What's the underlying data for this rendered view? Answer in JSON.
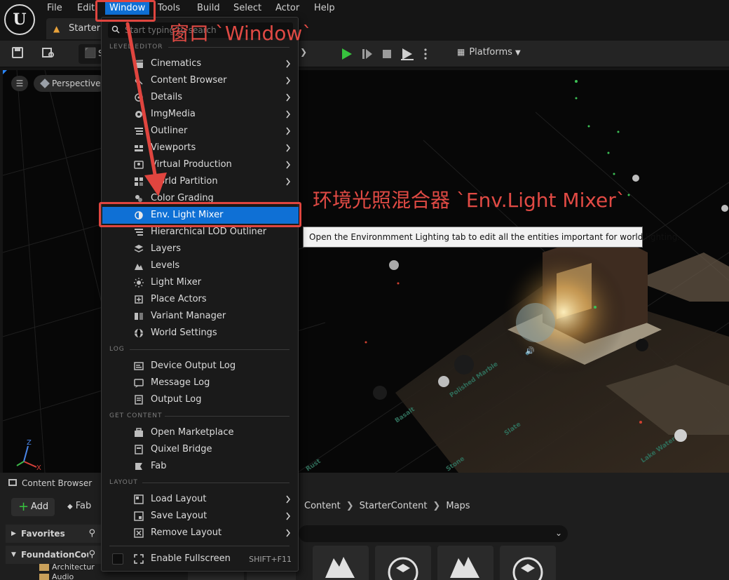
{
  "menubar": {
    "logo": "U",
    "items": [
      "File",
      "Edit",
      "Window",
      "Tools",
      "Build",
      "Select",
      "Actor",
      "Help"
    ],
    "tab_label": "StarterM"
  },
  "toolbar": {
    "mode_label": "S",
    "platforms_label": "Platforms"
  },
  "viewport": {
    "perspective_label": "Perspective",
    "axis_labels": {
      "x": "X",
      "z": "Z"
    },
    "floor_labels": [
      "Basalt",
      "Polished Marble",
      "Slate",
      "Lake Water",
      "Stone",
      "Rust"
    ]
  },
  "annotations": {
    "window_callout": "窗口 `Window`",
    "env_callout": "环境光照混合器 `Env.Light Mixer`"
  },
  "tooltip": {
    "text": "Open the Environmment Lighting tab to edit all the entities important for world lighting."
  },
  "dropdown": {
    "search_placeholder": "Start typing to search",
    "sections": {
      "level_editor": "LEVEL EDITOR",
      "log": "LOG",
      "get_content": "GET CONTENT",
      "layout": "LAYOUT"
    },
    "level_editor_items": [
      {
        "label": "Cinematics",
        "icon": "clapperboard-icon",
        "submenu": true
      },
      {
        "label": "Content Browser",
        "icon": "content-browser-icon",
        "submenu": true
      },
      {
        "label": "Details",
        "icon": "details-icon",
        "submenu": true
      },
      {
        "label": "ImgMedia",
        "icon": "img-media-icon",
        "submenu": true
      },
      {
        "label": "Outliner",
        "icon": "outliner-icon",
        "submenu": true
      },
      {
        "label": "Viewports",
        "icon": "viewports-icon",
        "submenu": true
      },
      {
        "label": "Virtual Production",
        "icon": "virtual-production-icon",
        "submenu": true
      },
      {
        "label": "World Partition",
        "icon": "world-partition-icon",
        "submenu": true
      },
      {
        "label": "Color Grading",
        "icon": "color-grading-icon",
        "submenu": false
      },
      {
        "label": "Env. Light Mixer",
        "icon": "env-light-mixer-icon",
        "submenu": false,
        "highlighted": true
      },
      {
        "label": "Hierarchical LOD Outliner",
        "icon": "hlod-outliner-icon",
        "submenu": false
      },
      {
        "label": "Layers",
        "icon": "layers-icon",
        "submenu": false
      },
      {
        "label": "Levels",
        "icon": "levels-icon",
        "submenu": false
      },
      {
        "label": "Light Mixer",
        "icon": "light-mixer-icon",
        "submenu": false
      },
      {
        "label": "Place Actors",
        "icon": "place-actors-icon",
        "submenu": false
      },
      {
        "label": "Variant Manager",
        "icon": "variant-manager-icon",
        "submenu": false
      },
      {
        "label": "World Settings",
        "icon": "world-settings-icon",
        "submenu": false
      }
    ],
    "log_items": [
      {
        "label": "Device Output Log",
        "icon": "device-output-log-icon"
      },
      {
        "label": "Message Log",
        "icon": "message-log-icon"
      },
      {
        "label": "Output Log",
        "icon": "output-log-icon"
      }
    ],
    "get_content_items": [
      {
        "label": "Open Marketplace",
        "icon": "marketplace-icon"
      },
      {
        "label": "Quixel Bridge",
        "icon": "quixel-bridge-icon"
      },
      {
        "label": "Fab",
        "icon": "fab-icon"
      }
    ],
    "layout_items": [
      {
        "label": "Load Layout",
        "icon": "load-layout-icon",
        "submenu": true
      },
      {
        "label": "Save Layout",
        "icon": "save-layout-icon",
        "submenu": true
      },
      {
        "label": "Remove Layout",
        "icon": "remove-layout-icon",
        "submenu": true
      }
    ],
    "fullscreen": {
      "label": "Enable Fullscreen",
      "shortcut": "SHIFT+F11",
      "checked": false
    }
  },
  "content_browser": {
    "tab_label": "Content Browser",
    "add_label": "Add",
    "fab_label": "Fab",
    "favorites_label": "Favorites",
    "foundation_label": "FoundationCou",
    "folders": [
      "Architectur",
      "Audio"
    ],
    "breadcrumb": [
      "Content",
      "StarterContent",
      "Maps"
    ]
  },
  "colors": {
    "accent": "#0f70d5",
    "annotation": "#e0453f",
    "play": "#37c43e"
  }
}
